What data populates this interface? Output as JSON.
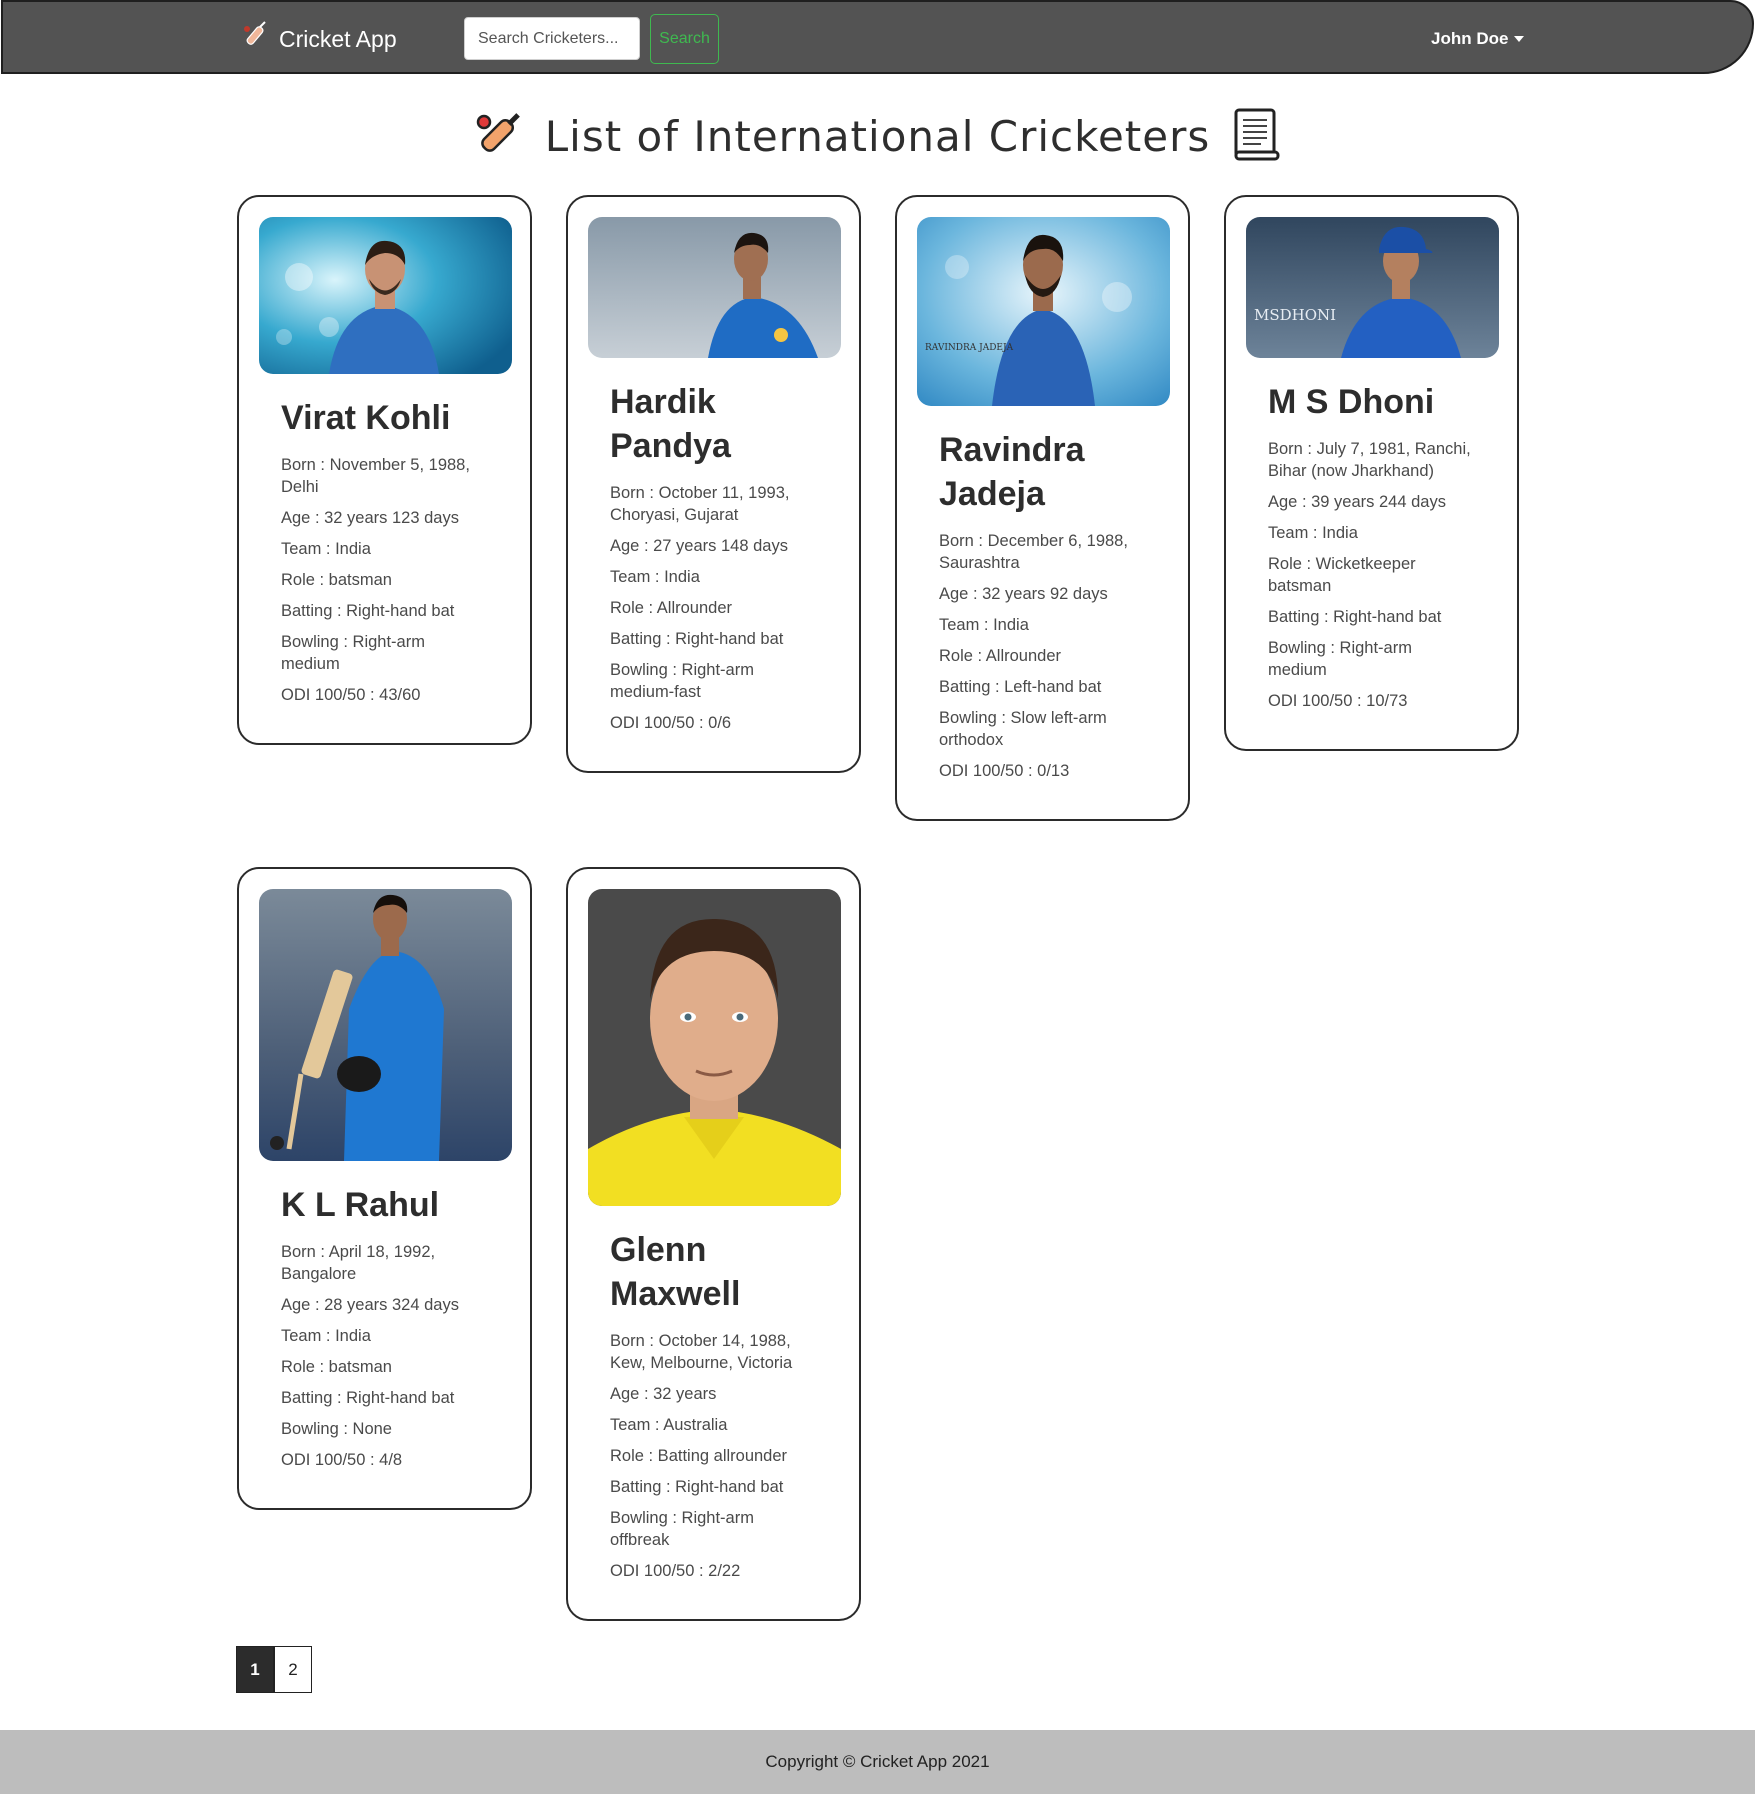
{
  "navbar": {
    "brand": "Cricket App",
    "search_placeholder": "Search Cricketers...",
    "search_button": "Search",
    "user_name": "John Doe"
  },
  "heading": {
    "title": "List of International Cricketers"
  },
  "players": [
    {
      "name": "Virat Kohli",
      "born": "Born : November 5, 1988, Delhi",
      "age": "Age : 32 years 123 days",
      "team": "Team : India",
      "role": "Role : batsman",
      "batting": "Batting : Right-hand bat",
      "bowling": "Bowling : Right-arm medium",
      "odi": "ODI 100/50 : 43/60"
    },
    {
      "name": "Hardik Pandya",
      "born": "Born : October 11, 1993, Choryasi, Gujarat",
      "age": "Age : 27 years 148 days",
      "team": "Team : India",
      "role": "Role : Allrounder",
      "batting": "Batting : Right-hand bat",
      "bowling": "Bowling : Right-arm medium-fast",
      "odi": "ODI 100/50 : 0/6"
    },
    {
      "name": "Ravindra Jadeja",
      "born": "Born : December 6, 1988, Saurashtra",
      "age": "Age : 32 years 92 days",
      "team": "Team : India",
      "role": "Role : Allrounder",
      "batting": "Batting : Left-hand bat",
      "bowling": "Bowling : Slow left-arm orthodox",
      "odi": "ODI 100/50 : 0/13",
      "photo_caption": "RAVINDRA JADEJA"
    },
    {
      "name": "M S Dhoni",
      "born": "Born : July 7, 1981, Ranchi, Bihar (now Jharkhand)",
      "age": "Age : 39 years 244 days",
      "team": "Team : India",
      "role": "Role : Wicketkeeper batsman",
      "batting": "Batting : Right-hand bat",
      "bowling": "Bowling : Right-arm medium",
      "odi": "ODI 100/50 : 10/73",
      "photo_caption": "MSDHONI"
    },
    {
      "name": "K L Rahul",
      "born": "Born : April 18, 1992, Bangalore",
      "age": "Age : 28 years 324 days",
      "team": "Team : India",
      "role": "Role : batsman",
      "batting": "Batting : Right-hand bat",
      "bowling": "Bowling : None",
      "odi": "ODI 100/50 : 4/8"
    },
    {
      "name": "Glenn Maxwell",
      "born": "Born : October 14, 1988, Kew, Melbourne, Victoria",
      "age": "Age : 32 years",
      "team": "Team : Australia",
      "role": "Role : Batting allrounder",
      "batting": "Batting : Right-hand bat",
      "bowling": "Bowling : Right-arm offbreak",
      "odi": "ODI 100/50 : 2/22"
    }
  ],
  "pagination": {
    "pages": [
      "1",
      "2"
    ],
    "active": "1"
  },
  "footer": {
    "text": "Copyright © Cricket App 2021"
  },
  "colors": {
    "navbar_bg": "#535353",
    "search_button": "#3fb950",
    "footer_bg": "#bdbdbd",
    "pagination_active": "#2c2c2c",
    "jersey_india": "#2f6fc0",
    "jersey_australia": "#f2df22"
  },
  "icons": {
    "brand": "cricket-bat-icon",
    "heading_left": "cricket-bat-icon",
    "heading_right": "scroll-document-icon",
    "user_dropdown": "caret-down-icon"
  }
}
